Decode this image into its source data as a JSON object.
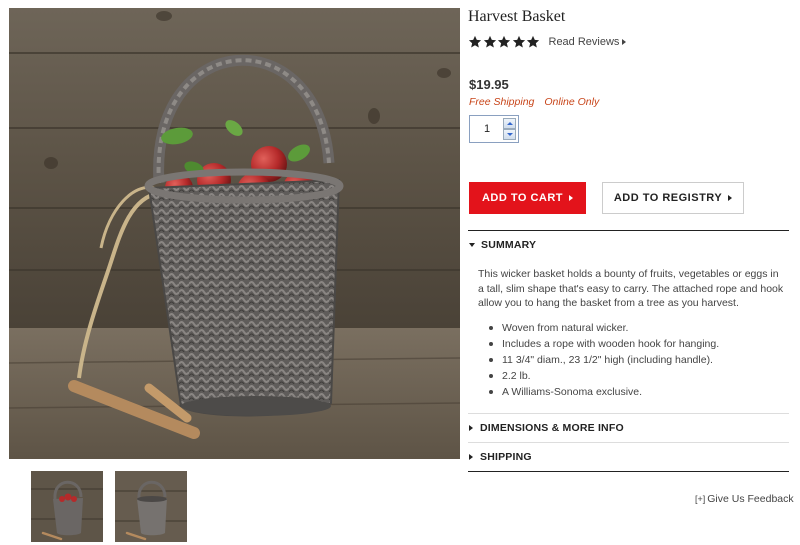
{
  "product": {
    "title": "Harvest Basket",
    "rating": 5,
    "rating_max": 5,
    "read_reviews_label": "Read Reviews",
    "price": "$19.95",
    "free_shipping": "Free Shipping",
    "online_only": "Online Only",
    "quantity": "1"
  },
  "buttons": {
    "add_to_cart": "ADD TO CART",
    "add_to_registry": "ADD TO REGISTRY"
  },
  "summary": {
    "heading": "SUMMARY",
    "text": "This wicker basket holds a bounty of fruits, vegetables or eggs in a tall, slim shape that's easy to carry. The attached rope and hook allow you to hang the basket from a tree as you harvest.",
    "bullets": [
      "Woven from natural wicker.",
      "Includes a rope with wooden hook for hanging.",
      "11 3/4\" diam., 23 1/2\" high (including handle).",
      "2.2 lb.",
      "A Williams-Sonoma exclusive."
    ]
  },
  "sections": {
    "dimensions": "DIMENSIONS & MORE INFO",
    "shipping": "SHIPPING"
  },
  "feedback": {
    "plus": "[+]",
    "label": "Give Us Feedback"
  },
  "colors": {
    "accent_red": "#e3131b",
    "promo_orange": "#c8451a"
  },
  "icons": [
    "star-icon",
    "caret-right-icon",
    "caret-down-icon",
    "spin-up-icon",
    "spin-down-icon"
  ]
}
